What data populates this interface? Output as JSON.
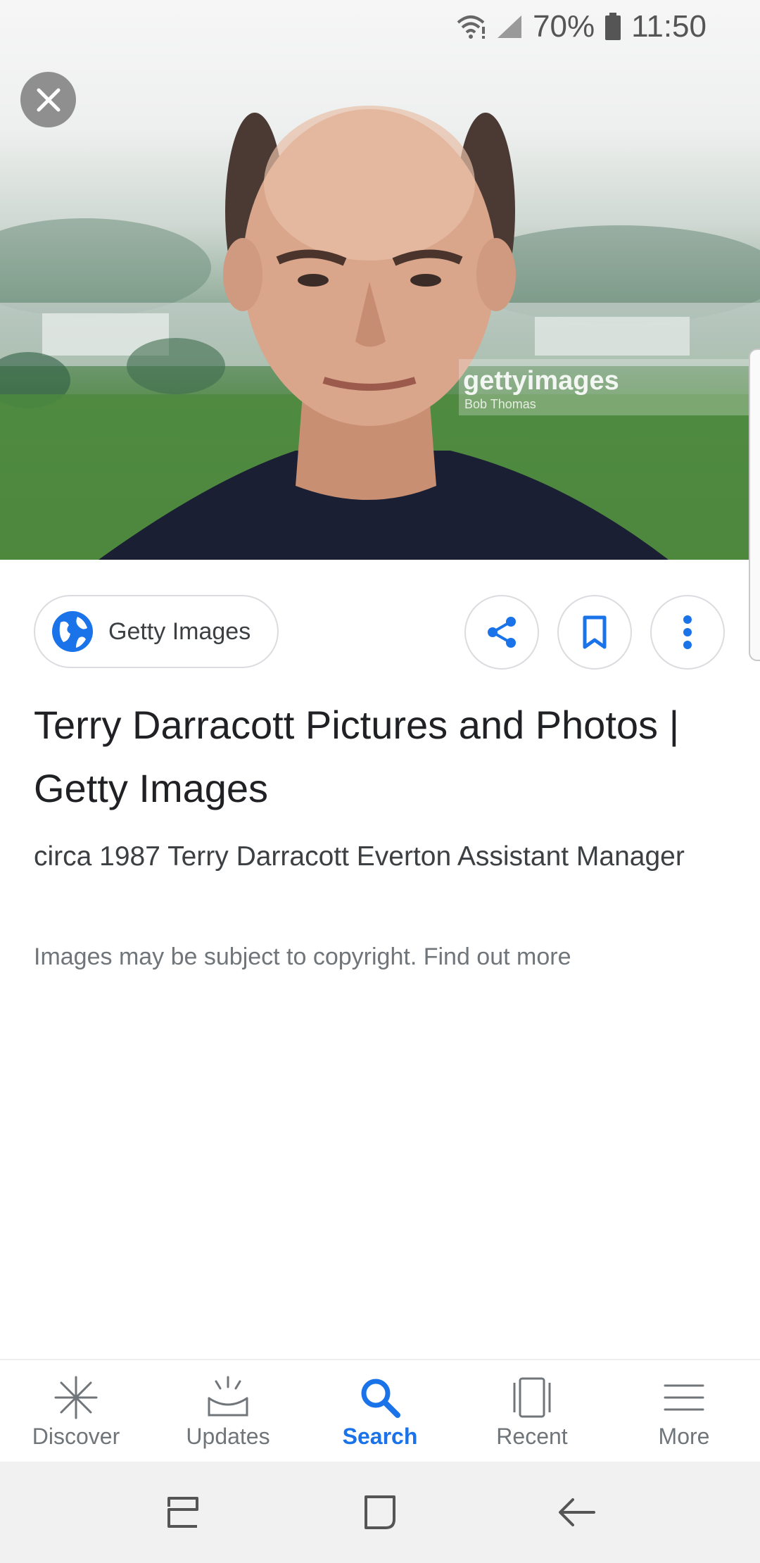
{
  "status_bar": {
    "battery_percent": "70%",
    "time": "11:50",
    "icons": [
      "wifi-icon",
      "signal-icon",
      "battery-icon"
    ]
  },
  "image_panel": {
    "close_icon": "close-icon",
    "watermark_brand": "gettyimages",
    "watermark_credit": "Bob Thomas"
  },
  "actions": {
    "source_label": "Getty Images",
    "source_icon": "globe-icon",
    "buttons": [
      "share-icon",
      "bookmark-icon",
      "more-vert-icon"
    ]
  },
  "result": {
    "title": "Terry Darracott Pictures and Photos | Getty Images",
    "description": "circa 1987 Terry Darracott Everton Assistant Manager",
    "copyright_note": "Images may be subject to copyright. Find out more"
  },
  "bottom_nav": {
    "items": [
      {
        "label": "Discover",
        "icon": "discover-icon",
        "active": false
      },
      {
        "label": "Updates",
        "icon": "updates-icon",
        "active": false
      },
      {
        "label": "Search",
        "icon": "search-icon",
        "active": true
      },
      {
        "label": "Recent",
        "icon": "recent-icon",
        "active": false
      },
      {
        "label": "More",
        "icon": "menu-icon",
        "active": false
      }
    ]
  },
  "system_nav": [
    "recents-button",
    "home-button",
    "back-button"
  ],
  "colors": {
    "accent": "#1a73e8",
    "nav_inactive": "#70757a",
    "system_nav_bg": "#f1f1f1"
  }
}
